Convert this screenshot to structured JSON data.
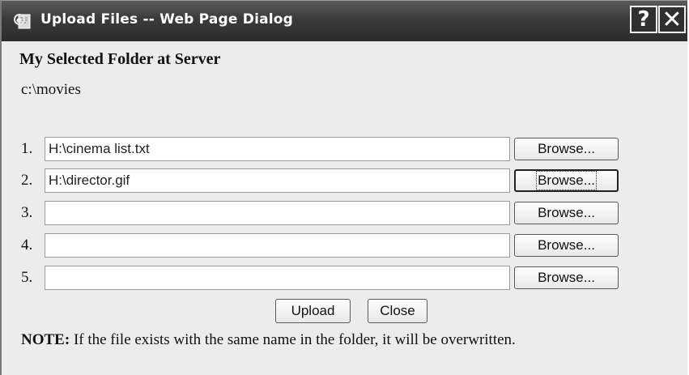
{
  "window": {
    "title": "Upload Files -- Web Page Dialog",
    "help_symbol": "?",
    "close_symbol": "✕",
    "icon": "ie-page-icon"
  },
  "folder": {
    "heading": "My Selected Folder at Server",
    "path": "c:\\movies"
  },
  "files": [
    {
      "number": "1.",
      "value": "H:\\cinema list.txt",
      "browse_label": "Browse..."
    },
    {
      "number": "2.",
      "value": "H:\\director.gif",
      "browse_label": "Browse..."
    },
    {
      "number": "3.",
      "value": "",
      "browse_label": "Browse..."
    },
    {
      "number": "4.",
      "value": "",
      "browse_label": "Browse..."
    },
    {
      "number": "5.",
      "value": "",
      "browse_label": "Browse..."
    }
  ],
  "actions": {
    "upload_label": "Upload",
    "close_label": "Close"
  },
  "note": {
    "label": "NOTE:",
    "text": " If the file exists with the same name in the folder, it will be overwritten."
  }
}
